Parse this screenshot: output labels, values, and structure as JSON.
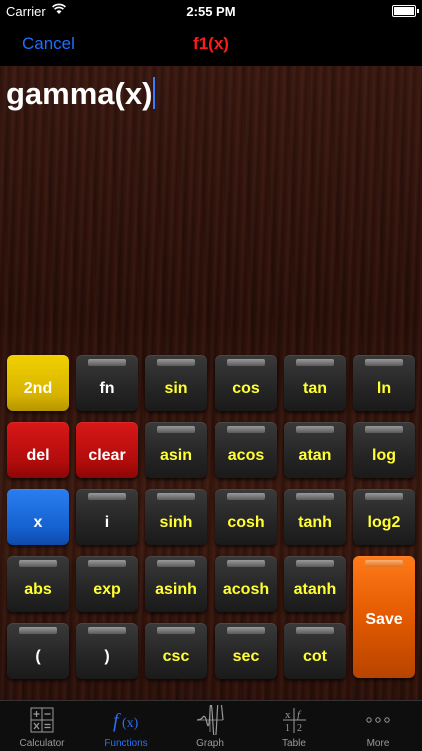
{
  "status": {
    "carrier": "Carrier",
    "time": "2:55 PM"
  },
  "nav": {
    "cancel": "Cancel",
    "title": "f1(x)"
  },
  "expression": "gamma(x)",
  "keys": [
    {
      "label": "2nd"
    },
    {
      "label": "fn"
    },
    {
      "label": "sin"
    },
    {
      "label": "cos"
    },
    {
      "label": "tan"
    },
    {
      "label": "ln"
    },
    {
      "label": "del"
    },
    {
      "label": "clear"
    },
    {
      "label": "asin"
    },
    {
      "label": "acos"
    },
    {
      "label": "atan"
    },
    {
      "label": "log"
    },
    {
      "label": "x"
    },
    {
      "label": "i"
    },
    {
      "label": "sinh"
    },
    {
      "label": "cosh"
    },
    {
      "label": "tanh"
    },
    {
      "label": "log2"
    },
    {
      "label": "abs"
    },
    {
      "label": "exp"
    },
    {
      "label": "asinh"
    },
    {
      "label": "acosh"
    },
    {
      "label": "atanh"
    },
    {
      "label": "Save"
    },
    {
      "label": "("
    },
    {
      "label": ")"
    },
    {
      "label": "csc"
    },
    {
      "label": "sec"
    },
    {
      "label": "cot"
    }
  ],
  "tabs": [
    {
      "label": "Calculator",
      "icon": "calculator-icon"
    },
    {
      "label": "Functions",
      "icon": "function-icon"
    },
    {
      "label": "Graph",
      "icon": "graph-icon"
    },
    {
      "label": "Table",
      "icon": "table-icon"
    },
    {
      "label": "More",
      "icon": "more-icon"
    }
  ],
  "colors": {
    "accent": "#2d6ff0",
    "title": "#ff1a1a",
    "key_text": "#ffff33",
    "key_2nd": "#e0c000",
    "key_red": "#c41010",
    "key_blue": "#1e6fe0",
    "key_save": "#f06a00"
  }
}
